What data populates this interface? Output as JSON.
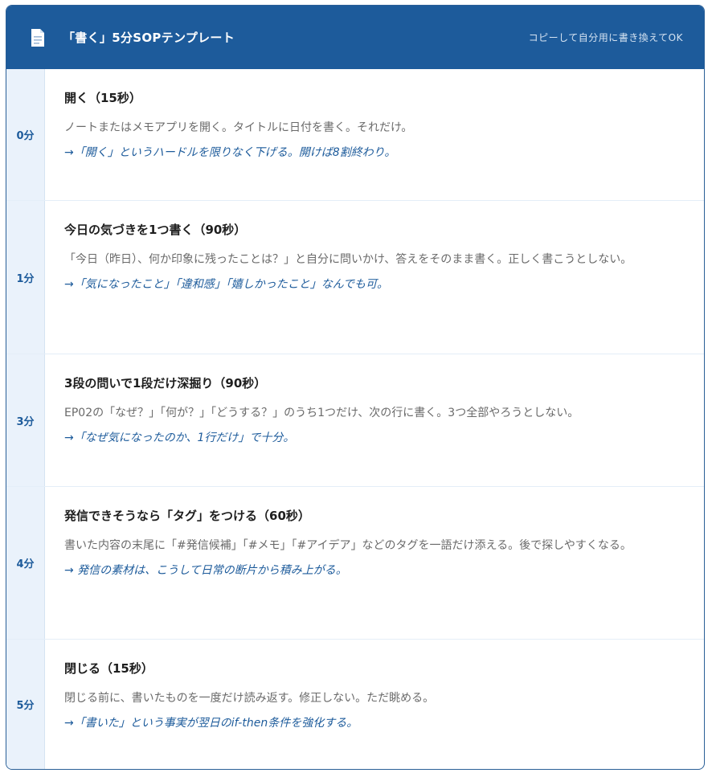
{
  "header": {
    "title": "「書く」5分SOPテンプレート",
    "subtitle": "コピーして自分用に書き換えてOK",
    "icon": "document-icon"
  },
  "steps": [
    {
      "time": "0分",
      "title": "開く（15秒）",
      "body": "ノートまたはメモアプリを開く。タイトルに日付を書く。それだけ。",
      "note": "→「開く」というハードルを限りなく下げる。開けば8割終わり。"
    },
    {
      "time": "1分",
      "title": "今日の気づきを1つ書く（90秒）",
      "body": "「今日（昨日）、何か印象に残ったことは？」と自分に問いかけ、答えをそのまま書く。正しく書こうとしない。",
      "note": "→「気になったこと」「違和感」「嬉しかったこと」なんでも可。"
    },
    {
      "time": "3分",
      "title": "3段の問いで1段だけ深掘り（90秒）",
      "body": "EP02の「なぜ？」「何が？」「どうする？」のうち1つだけ、次の行に書く。3つ全部やろうとしない。",
      "note": "→「なぜ気になったのか、1行だけ」で十分。"
    },
    {
      "time": "4分",
      "title": "発信できそうなら「タグ」をつける（60秒）",
      "body": "書いた内容の末尾に「#発信候補」「#メモ」「#アイデア」などのタグを一語だけ添える。後で探しやすくなる。",
      "note": "→ 発信の素材は、こうして日常の断片から積み上がる。"
    },
    {
      "time": "5分",
      "title": "閉じる（15秒）",
      "body": "閉じる前に、書いたものを一度だけ読み返す。修正しない。ただ眺める。",
      "note": "→「書いた」という事実が翌日のif-then条件を強化する。"
    }
  ],
  "colors": {
    "header_bg": "#1d5b9b",
    "accent": "#1d5b9b",
    "time_bg": "#eaf2fb"
  }
}
